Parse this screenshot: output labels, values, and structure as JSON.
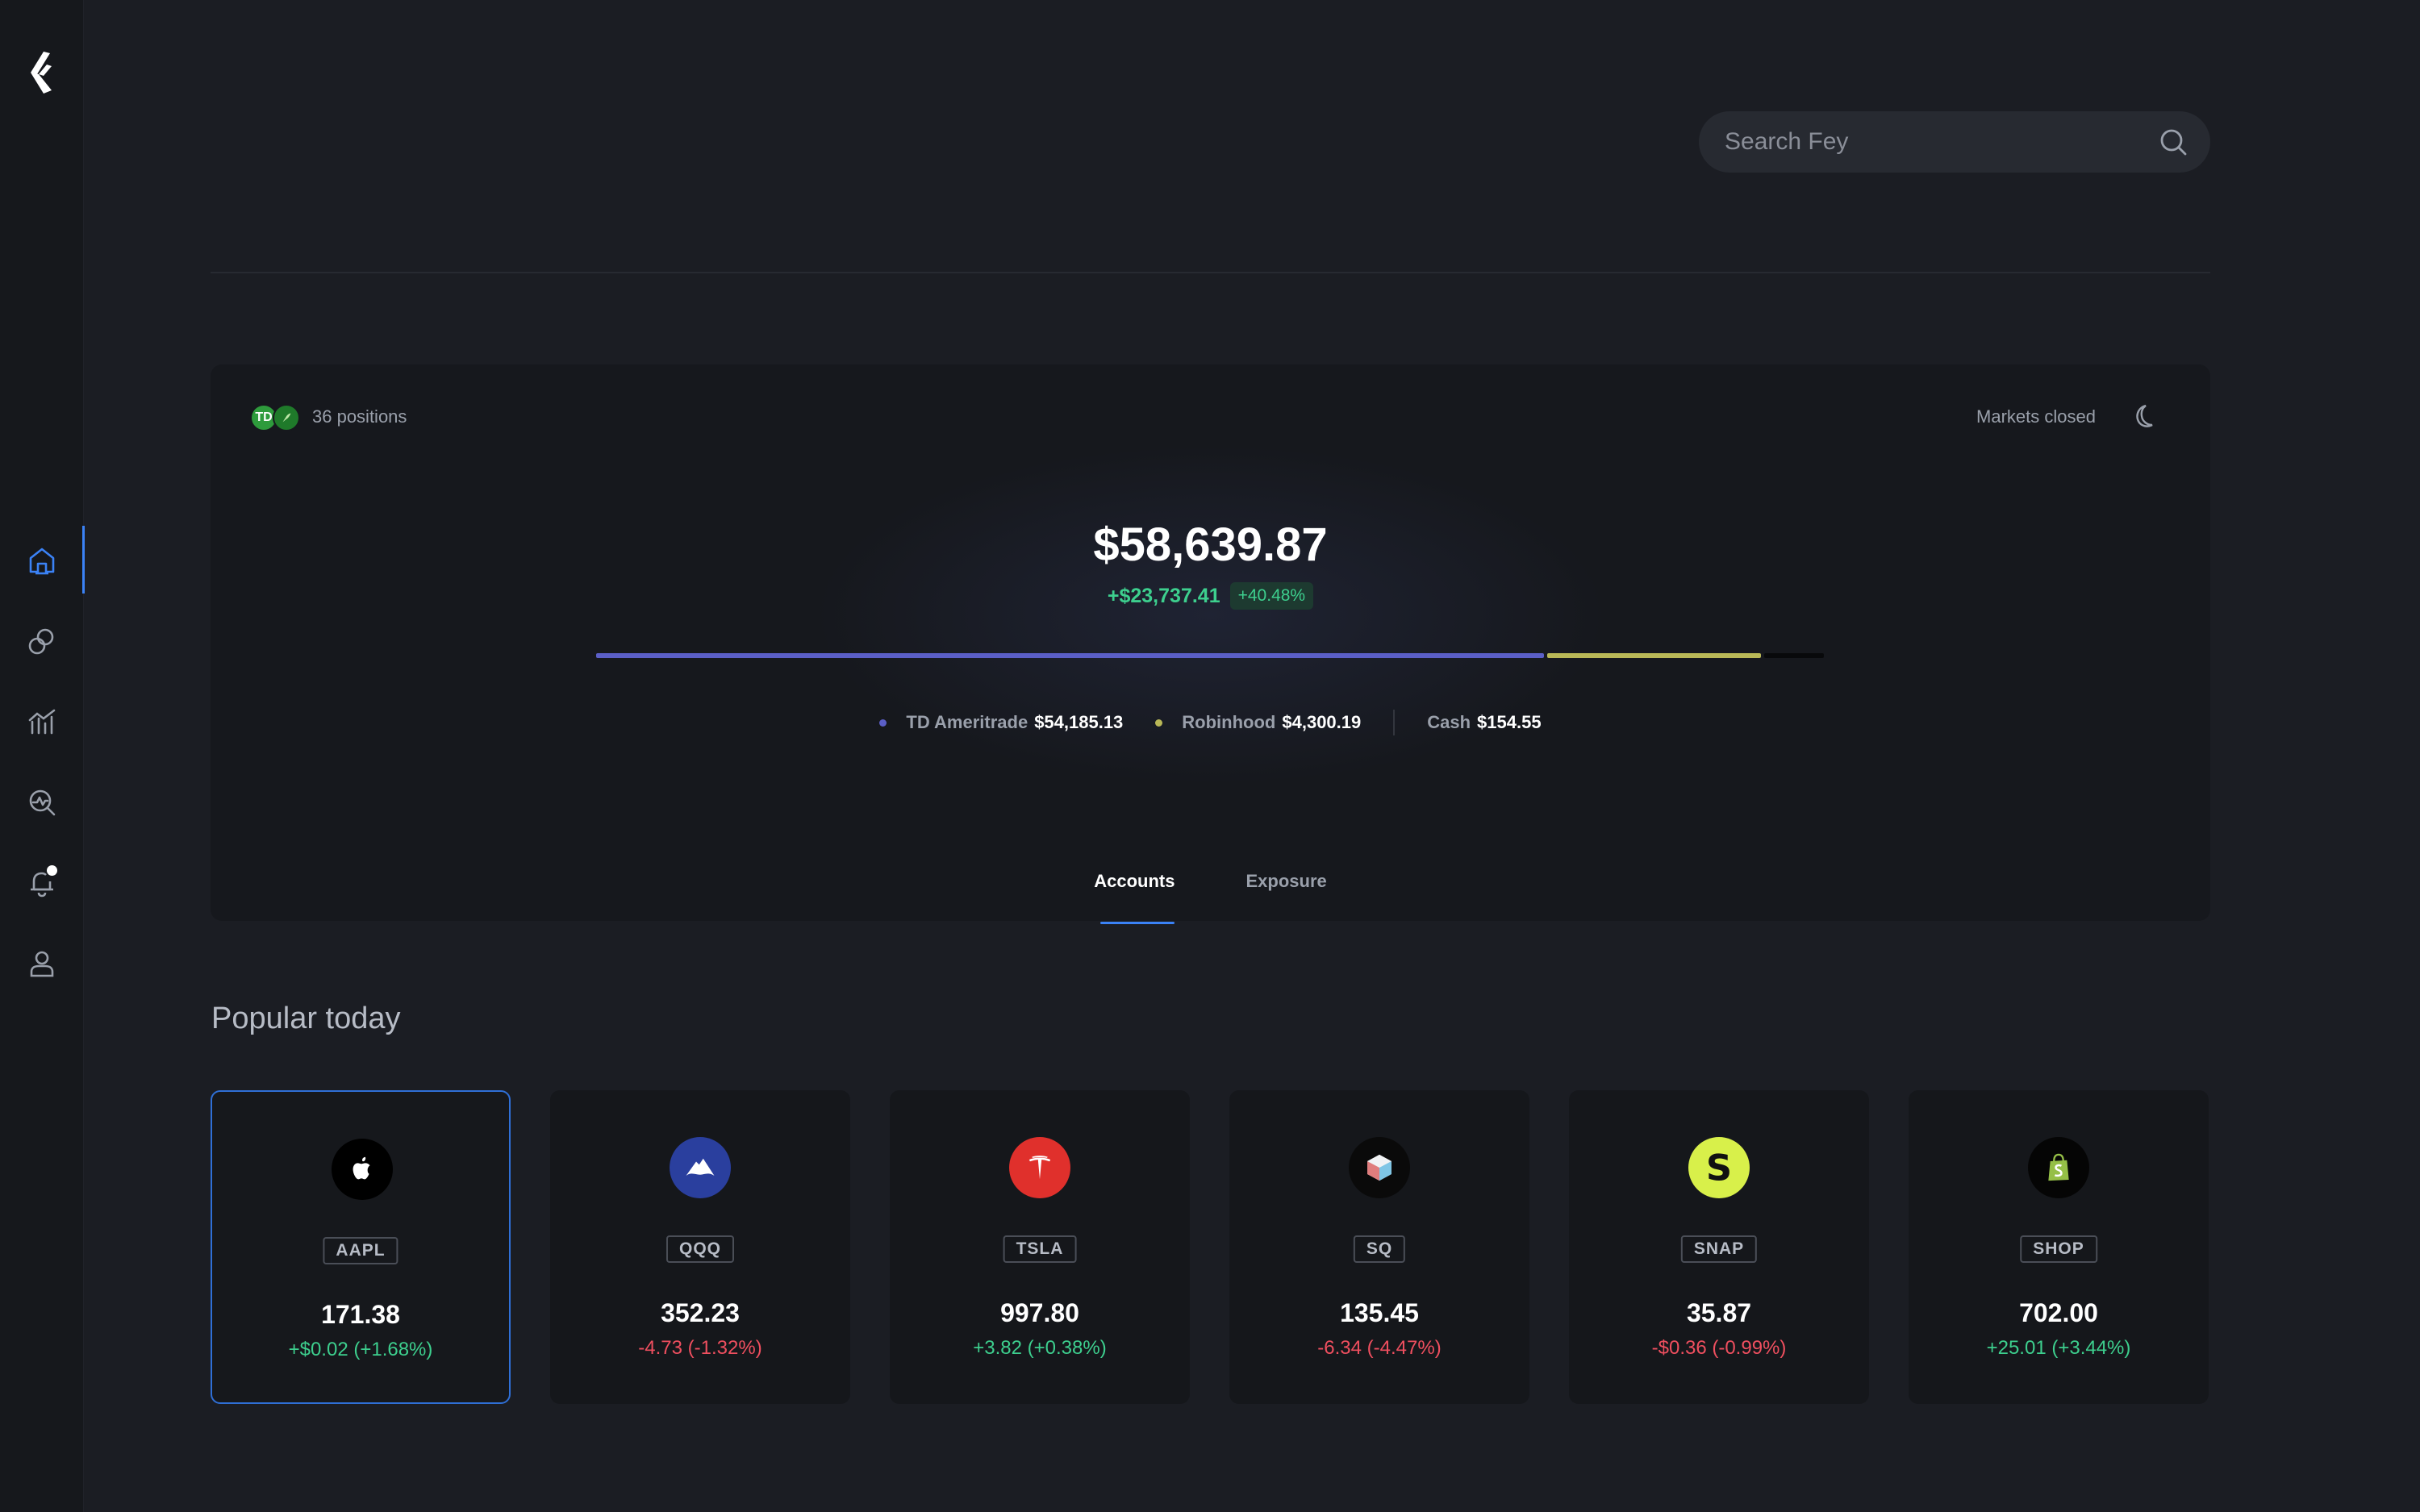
{
  "search": {
    "placeholder": "Search Fey"
  },
  "nav": {
    "items": [
      {
        "name": "home",
        "icon": "home-icon",
        "active": true
      },
      {
        "name": "ideas",
        "icon": "ideas-icon"
      },
      {
        "name": "markets",
        "icon": "chart-icon"
      },
      {
        "name": "screener",
        "icon": "search-chart-icon"
      },
      {
        "name": "alerts",
        "icon": "bell-icon",
        "badge": true
      },
      {
        "name": "profile",
        "icon": "user-icon"
      }
    ]
  },
  "portfolio": {
    "positions_label": "36 positions",
    "brokers": [
      "TD",
      "Robinhood"
    ],
    "market_status": "Markets closed",
    "total_value": "$58,639.87",
    "change_abs": "+$23,737.41",
    "change_pct": "+40.48%",
    "allocation": [
      {
        "name": "TD Ameritrade",
        "value": "$54,185.13",
        "share": 0.776,
        "color": "#5b5fc7"
      },
      {
        "name": "Robinhood",
        "value": "$4,300.19",
        "share": 0.175,
        "color": "#b9b857"
      },
      {
        "name": "Cash",
        "value": "$154.55",
        "share": 0.049,
        "color": "#08090b"
      }
    ],
    "tabs": [
      {
        "label": "Accounts",
        "active": true
      },
      {
        "label": "Exposure",
        "active": false
      }
    ]
  },
  "popular": {
    "title": "Popular today",
    "stocks": [
      {
        "ticker": "AAPL",
        "price": "171.38",
        "change": "+$0.02 (+1.68%)",
        "direction": "up",
        "logo_color": "#000000",
        "icon": "apple-icon"
      },
      {
        "ticker": "QQQ",
        "price": "352.23",
        "change": "-4.73 (-1.32%)",
        "direction": "down",
        "logo_color": "#2a3f9e",
        "icon": "invesco-icon"
      },
      {
        "ticker": "TSLA",
        "price": "997.80",
        "change": "+3.82 (+0.38%)",
        "direction": "up",
        "logo_color": "#e0302c",
        "icon": "tesla-icon"
      },
      {
        "ticker": "SQ",
        "price": "135.45",
        "change": "-6.34 (-4.47%)",
        "direction": "down",
        "logo_color": "#0a0a0a",
        "icon": "square-icon"
      },
      {
        "ticker": "SNAP",
        "price": "35.87",
        "change": "-$0.36 (-0.99%)",
        "direction": "down",
        "logo_color": "#d8f04a",
        "icon": "snap-icon"
      },
      {
        "ticker": "SHOP",
        "price": "702.00",
        "change": "+25.01 (+3.44%)",
        "direction": "up",
        "logo_color": "#050505",
        "icon": "shopify-icon"
      }
    ]
  }
}
